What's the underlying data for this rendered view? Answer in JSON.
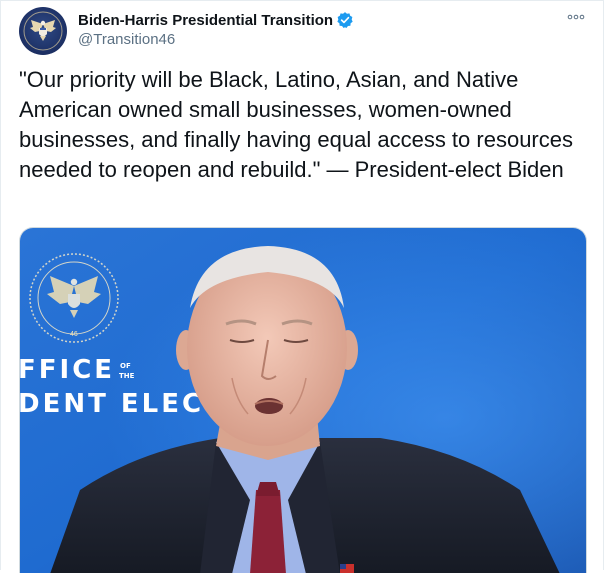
{
  "account": {
    "display_name": "Biden-Harris Presidential Transition",
    "handle": "@Transition46",
    "verified": true,
    "avatar_icon": "presidential-seal-icon"
  },
  "tweet": {
    "text": "\"Our priority will be Black, Latino, Asian, and Native American owned small businesses, women-owned businesses, and finally having equal access to resources needed to reopen and rebuild.\" — President-elect Biden"
  },
  "media": {
    "backdrop_text_line1": "FFICE",
    "backdrop_text_small1": "OF",
    "backdrop_text_small2": "THE",
    "backdrop_text_line2": "DENT ELEC",
    "seal_number": "46"
  },
  "colors": {
    "verified_blue": "#1d9bf0",
    "handle_gray": "#5b7083",
    "backdrop_blue": "#1e64c8"
  },
  "icons": {
    "more": "more-options-icon",
    "verified": "verified-badge-icon"
  }
}
